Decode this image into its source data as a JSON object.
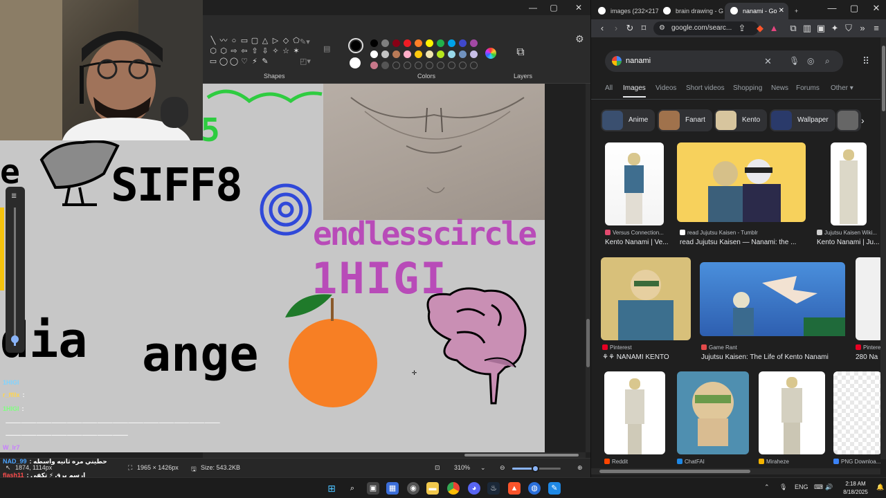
{
  "paint": {
    "ribbon": {
      "shapes_label": "Shapes",
      "colors_label": "Colors",
      "layers_label": "Layers",
      "shape_tools": [
        "╲",
        "〰",
        "○",
        "▭",
        "▢",
        "△",
        "▷",
        "◇",
        "⬠",
        "⬡",
        "⬡",
        "⇨",
        "⇦",
        "⇧",
        "⇩",
        "✧",
        "☆",
        "✶",
        "▭",
        "◯",
        "◯",
        "♡",
        "⚡",
        "✎"
      ],
      "swatches": [
        "#000000",
        "#7f7f7f",
        "#880015",
        "#ed1c24",
        "#ff7f27",
        "#fff200",
        "#22b14c",
        "#00a2e8",
        "#3f48cc",
        "#a349a4",
        "#ffffff",
        "#c3c3c3",
        "#b97a57",
        "#ffaec9",
        "#ffc90e",
        "#efe4b0",
        "#b5e61d",
        "#99d9ea",
        "#7092be",
        "#c8bfe7",
        "#c8788a",
        "#555555",
        "",
        "",
        "",
        "",
        "",
        "",
        "",
        ""
      ]
    },
    "canvas_text": {
      "top_scribble": "5",
      "sifr": "SIFF8",
      "endless": "endlesscircle",
      "higi": "1HIGI",
      "dia": "dia",
      "ange": "ange",
      "e_letter": "e"
    },
    "status": {
      "cursor_pos": "1874, 1114px",
      "dimensions": "1965 × 1426px",
      "size": "Size: 543.2KB",
      "zoom": "310%"
    }
  },
  "stream_chat": {
    "lines": [
      {
        "user": "1HIGI",
        "text": "",
        "color": "#7fd3ff"
      },
      {
        "user": "r_ffllx",
        "text": ":",
        "color": "#ffd54f"
      },
      {
        "user": "1HIGI",
        "text": ":",
        "color": "#7fff7f"
      },
      {
        "user": "",
        "text": "⸻⸻⸻⸻⸻⸻⸻⸻⸻⸻⸻⸻⸻⸻",
        "color": "#d6d6d6"
      },
      {
        "user": "",
        "text": "⸻⸻⸻⸻⸻⸻⸻⸻",
        "color": "#d6d6d6"
      },
      {
        "user": "W_lr7",
        "text": "",
        "color": "#c77dff"
      },
      {
        "user": "NAD_99",
        "text": ": حطيني مره ثانيه واسطه",
        "color": "#4aa3ff"
      },
      {
        "user": "flash11",
        "text": ": ارسم برق ⚡ تكفى",
        "color": "#ff4d4d"
      },
      {
        "user": "",
        "text": "ⵢⵢⵢⵢⵢⵢⵢⵢⵢⵢⵢⵢ",
        "color": "#ffffff"
      }
    ]
  },
  "chrome": {
    "tabs": [
      {
        "label": "images (232×217",
        "active": false
      },
      {
        "label": "brain drawing - G",
        "active": false
      },
      {
        "label": "nanami - Go",
        "active": true
      }
    ],
    "url": "google.com/searc...",
    "search_query": "nanami",
    "search_tabs": [
      "All",
      "Images",
      "Videos",
      "Short videos",
      "Shopping",
      "News",
      "Forums",
      "Other ▾"
    ],
    "active_search_tab": "Images",
    "chips": [
      "Anime",
      "Fanart",
      "Kento",
      "Wallpaper"
    ],
    "results": [
      {
        "source": "Versus Connection...",
        "title": "Kento Nanami | Ve...",
        "src_color": "#e34a6f"
      },
      {
        "source": "read Jujutsu Kaisen - Tumblr",
        "title": "read Jujutsu Kaisen — Nanami: the ...",
        "src_color": "#ffffff"
      },
      {
        "source": "Jujutsu Kaisen Wiki...",
        "title": "Kento Nanami | Ju...",
        "src_color": "#cfcfcf"
      },
      {
        "source": "Pinterest",
        "title": "⚘⚘ NANAMI KENTO",
        "src_color": "#e60023"
      },
      {
        "source": "Game Rant",
        "title": "Jujutsu Kaisen: The Life of Kento Nanami",
        "src_color": "#e34a4a"
      },
      {
        "source": "Pinterest",
        "title": "280 Na",
        "src_color": "#e60023"
      },
      {
        "source": "Reddit",
        "title": "",
        "src_color": "#ff4500"
      },
      {
        "source": "ChatFAI",
        "title": "",
        "src_color": "#1e88e5"
      },
      {
        "source": "Miraheze",
        "title": "",
        "src_color": "#f4b400"
      },
      {
        "source": "PNG Downloa...",
        "title": "",
        "src_color": "#3b82f6"
      }
    ]
  },
  "taskbar": {
    "lang": "ENG",
    "time": "2:18 AM",
    "date": "8/18/2025"
  }
}
